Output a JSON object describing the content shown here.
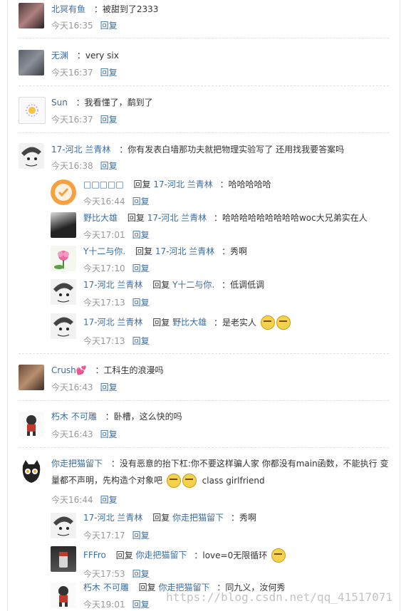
{
  "reply_label": "回复",
  "comments": [
    {
      "name": "北冥有鱼",
      "text": "：被甜到了2333",
      "time": "今天16:35"
    },
    {
      "name": "无渊",
      "text": "：very six",
      "time": "今天16:37"
    },
    {
      "name": "Sun",
      "text": "：我看懂了，鹬到了",
      "time": "今天16:37"
    },
    {
      "name": "17-河北 兰青林",
      "text": "：你有发表白墙那功夫就把物理实验写了 还用找我要答案吗",
      "time": "今天16:38",
      "replies": [
        {
          "name": "□□□□□",
          "to": "17-河北 兰青林",
          "text": "：哈哈哈哈哈",
          "time": "今天16:44"
        },
        {
          "name": "野比大雄",
          "to": "17-河北 兰青林",
          "text": "：哈哈哈哈哈哈哈哈哈woc大兄弟实在人",
          "time": "今天17:01"
        },
        {
          "name": "Y十二与你.",
          "to": "17-河北 兰青林",
          "text": "：秀啊",
          "time": "今天17:10"
        },
        {
          "name": "17-河北 兰青林",
          "to": "Y十二与你.",
          "text": "：低调低调",
          "time": "今天17:13"
        },
        {
          "name": "17-河北 兰青林",
          "to": "野比大雄",
          "text": "：是老实人",
          "time": "今天17:13"
        }
      ]
    },
    {
      "name": "Crush💕",
      "text": "：工科生的浪漫吗",
      "time": "今天16:43"
    },
    {
      "name": "朽木 不可雕",
      "text": "：卧槽，这么快的吗",
      "time": "今天16:43"
    },
    {
      "name": "你走把猫留下",
      "text": "：没有恶意的抬下杠:你不要这样骗人家 你都没有main函数，不能执行 变",
      "text2": "量都不声明，先构造个对象吧",
      "text3": "class girlfriend",
      "time": "今天16:44",
      "replies": [
        {
          "name": "17-河北 兰青林",
          "to": "你走把猫留下",
          "text": "：秀啊",
          "time": "今天17:17"
        },
        {
          "name": "FFFro",
          "to": "你走把猫留下",
          "text": "：love=0无限循环",
          "time": "今天17:53"
        },
        {
          "name": "朽木 不可雕",
          "to": "你走把猫留下",
          "text": "：同九义，汝何秀",
          "time": "今天19:01"
        }
      ]
    }
  ],
  "watermark": "https://blog.csdn.net/qq_41517071"
}
